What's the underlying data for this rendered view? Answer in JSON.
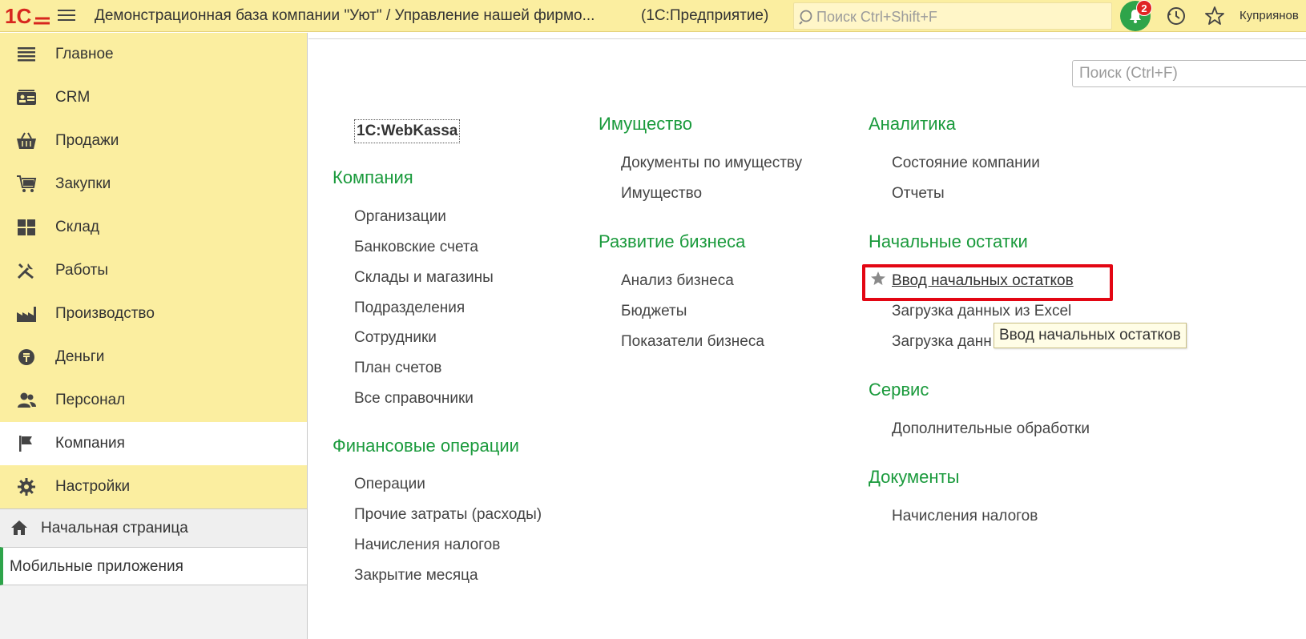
{
  "header": {
    "app_title": "Демонстрационная база компании \"Уют\" / Управление нашей фирмо...",
    "platform": "(1С:Предприятие)",
    "search_placeholder": "Поиск Ctrl+Shift+F",
    "notifications_count": "2",
    "user_name": "Куприянов"
  },
  "sidebar": {
    "items": [
      {
        "label": "Главное",
        "icon": "list-icon"
      },
      {
        "label": "CRM",
        "icon": "contact-card-icon"
      },
      {
        "label": "Продажи",
        "icon": "basket-icon"
      },
      {
        "label": "Закупки",
        "icon": "cart-icon"
      },
      {
        "label": "Склад",
        "icon": "warehouse-icon"
      },
      {
        "label": "Работы",
        "icon": "tools-icon"
      },
      {
        "label": "Производство",
        "icon": "factory-icon"
      },
      {
        "label": "Деньги",
        "icon": "money-icon"
      },
      {
        "label": "Персонал",
        "icon": "people-icon"
      },
      {
        "label": "Компания",
        "icon": "flag-icon"
      },
      {
        "label": "Настройки",
        "icon": "gear-icon"
      }
    ],
    "active_item": "Компания",
    "home_label": "Начальная страница",
    "mobile_label": "Мобильные приложения"
  },
  "main": {
    "search_placeholder": "Поиск (Ctrl+F)",
    "webkassa": "1C:WebKassa",
    "col1": {
      "section_company": "Компания",
      "company_links": [
        "Организации",
        "Банковские счета",
        "Склады и магазины",
        "Подразделения",
        "Сотрудники",
        "План счетов",
        "Все справочники"
      ],
      "section_finops": "Финансовые операции",
      "finops_links": [
        "Операции",
        "Прочие затраты (расходы)",
        "Начисления налогов",
        "Закрытие месяца"
      ]
    },
    "col2": {
      "section_property": "Имущество",
      "property_links": [
        "Документы по имуществу",
        "Имущество"
      ],
      "section_business": "Развитие бизнеса",
      "business_links": [
        "Анализ бизнеса",
        "Бюджеты",
        "Показатели бизнеса"
      ]
    },
    "col3": {
      "section_analytics": "Аналитика",
      "analytics_links": [
        "Состояние компании",
        "Отчеты"
      ],
      "section_opening": "Начальные остатки",
      "opening_links": [
        "Ввод начальных остатков",
        "Загрузка данных из Excel",
        "Загрузка данн"
      ],
      "section_service": "Сервис",
      "service_links": [
        "Дополнительные обработки"
      ],
      "section_docs": "Документы",
      "docs_links": [
        "Начисления налогов"
      ]
    },
    "tooltip": "Ввод начальных остатков"
  },
  "colors": {
    "accent_yellow": "#fbeea0",
    "section_green": "#1a9a3c",
    "highlight_red": "#e30613"
  }
}
